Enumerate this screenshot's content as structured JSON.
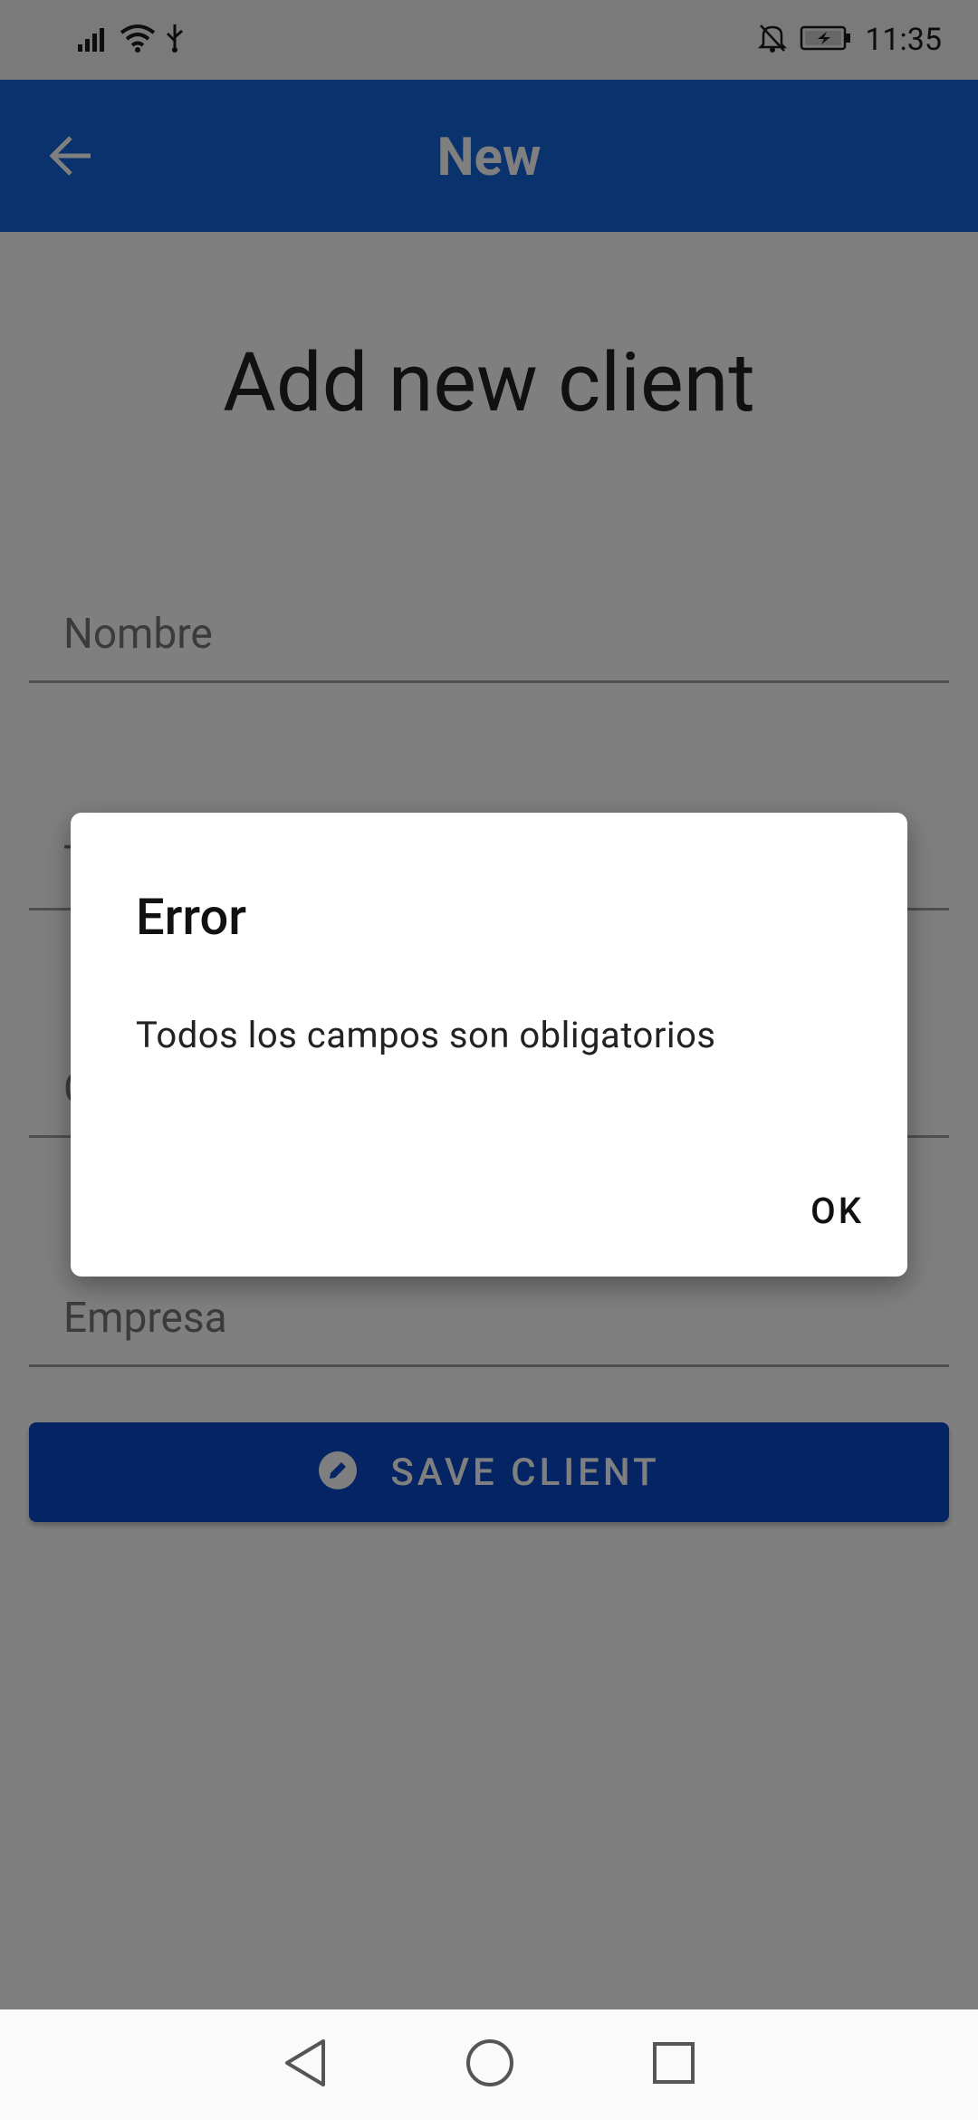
{
  "status_bar": {
    "time": "11:35",
    "icons": [
      "signal-icon",
      "wifi-icon",
      "usb-icon",
      "notifications-off-icon",
      "battery-charging-icon"
    ]
  },
  "app_bar": {
    "title": "New",
    "back_icon": "arrow-back-icon",
    "color": "#1565d8"
  },
  "page": {
    "heading": "Add new client"
  },
  "form": {
    "fields": [
      {
        "name": "nombre",
        "placeholder": "Nombre",
        "value": ""
      },
      {
        "name": "telefono",
        "placeholder": "T",
        "value": ""
      },
      {
        "name": "correo",
        "placeholder": "C",
        "value": ""
      },
      {
        "name": "empresa",
        "placeholder": "Empresa",
        "value": ""
      }
    ],
    "save_button": {
      "label": "SAVE CLIENT",
      "icon": "edit-icon",
      "color": "#0b49c7"
    }
  },
  "dialog": {
    "title": "Error",
    "message": "Todos los campos son obligatorios",
    "ok_label": "OK"
  },
  "nav_bar": {
    "icons": [
      "back-triangle-icon",
      "home-circle-icon",
      "recents-square-icon"
    ]
  }
}
